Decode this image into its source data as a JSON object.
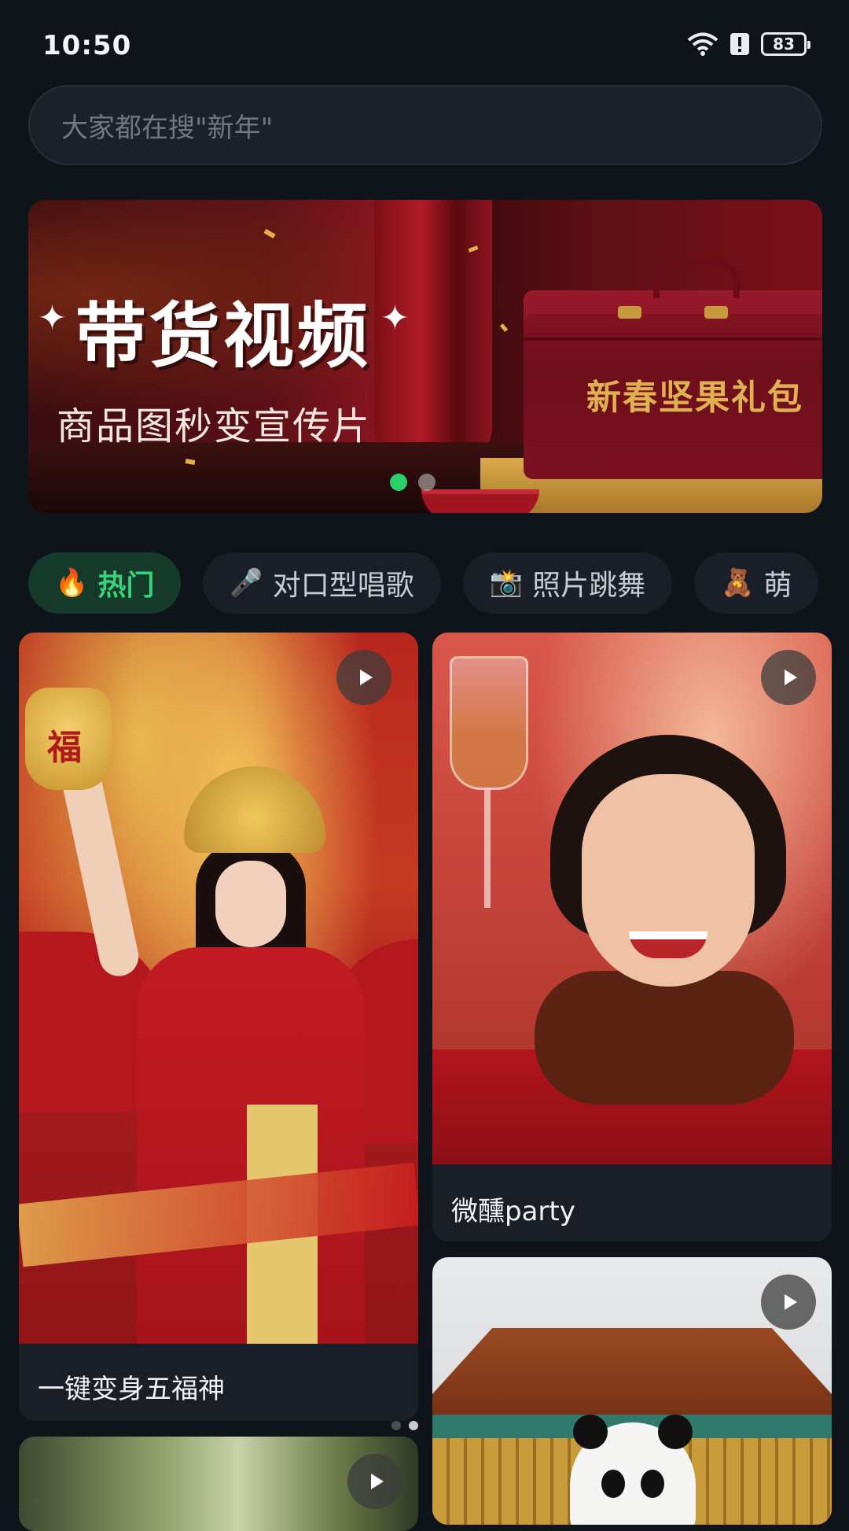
{
  "status_bar": {
    "time": "10:50",
    "battery": "83"
  },
  "search": {
    "placeholder": "大家都在搜\"新年\""
  },
  "banner": {
    "title": "带货视频",
    "subtitle": "商品图秒变宣传片",
    "product_text": "新春坚果礼包",
    "page_count": 2,
    "active_index": 0
  },
  "categories": [
    {
      "icon": "🔥",
      "label": "热门",
      "active": true
    },
    {
      "icon": "🎤",
      "label": "对口型唱歌",
      "active": false
    },
    {
      "icon": "📸",
      "label": "照片跳舞",
      "active": false
    },
    {
      "icon": "🧸",
      "label": "萌",
      "active": false
    }
  ],
  "cards": [
    {
      "label": "一键变身五福神",
      "bag_text": "福"
    },
    {
      "label": "微醺party"
    },
    {
      "label": ""
    },
    {
      "label": ""
    }
  ],
  "colors": {
    "accent": "#29d06b",
    "background": "#0f131a"
  }
}
